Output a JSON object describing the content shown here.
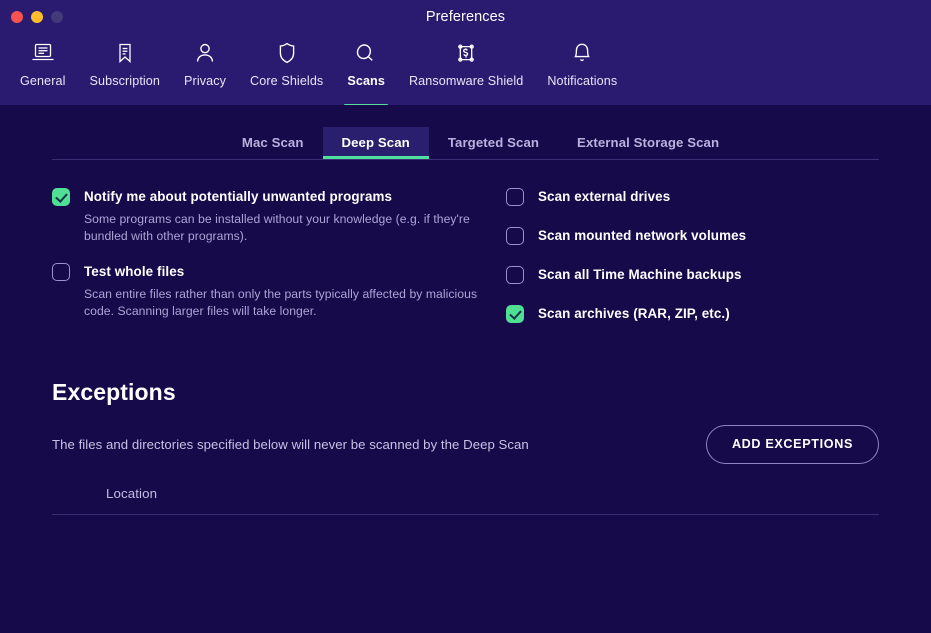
{
  "window": {
    "title": "Preferences",
    "traffic_lights": [
      {
        "name": "close",
        "color": "#f9534f"
      },
      {
        "name": "minimize",
        "color": "#fdbc2c"
      },
      {
        "name": "zoom",
        "color": "#433a7a"
      }
    ]
  },
  "toolbar": {
    "items": [
      {
        "label": "General",
        "icon": "document-laptop-icon",
        "active": false
      },
      {
        "label": "Subscription",
        "icon": "bookmark-icon",
        "active": false
      },
      {
        "label": "Privacy",
        "icon": "person-icon",
        "active": false
      },
      {
        "label": "Core Shields",
        "icon": "shield-icon",
        "active": false
      },
      {
        "label": "Scans",
        "icon": "magnifier-icon",
        "active": true
      },
      {
        "label": "Ransomware Shield",
        "icon": "money-lock-icon",
        "active": false
      },
      {
        "label": "Notifications",
        "icon": "bell-icon",
        "active": false
      }
    ]
  },
  "subtabs": [
    {
      "label": "Mac Scan",
      "active": false
    },
    {
      "label": "Deep Scan",
      "active": true
    },
    {
      "label": "Targeted Scan",
      "active": false
    },
    {
      "label": "External Storage Scan",
      "active": false
    }
  ],
  "options": {
    "left": [
      {
        "label": "Notify me about potentially unwanted programs",
        "checked": true,
        "description": "Some programs can be installed without your knowledge (e.g. if they're bundled with other programs)."
      },
      {
        "label": "Test whole files",
        "checked": false,
        "description": "Scan entire files rather than only the parts typically affected by malicious code. Scanning larger files will take longer."
      }
    ],
    "right": [
      {
        "label": "Scan external drives",
        "checked": false
      },
      {
        "label": "Scan mounted network volumes",
        "checked": false
      },
      {
        "label": "Scan all Time Machine backups",
        "checked": false
      },
      {
        "label": "Scan archives (RAR, ZIP, etc.)",
        "checked": true
      }
    ]
  },
  "exceptions": {
    "title": "Exceptions",
    "description": "The files and directories specified below will never be scanned by the Deep Scan",
    "add_button": "ADD EXCEPTIONS",
    "table": {
      "columns": [
        "Location"
      ],
      "rows": []
    }
  },
  "colors": {
    "accent_green": "#4fe0a0",
    "header_bg": "#2a1a70",
    "body_bg": "#170a4a",
    "active_tab_bg": "#2a1f6e",
    "muted_text": "#ada4d6",
    "divider": "#3a2f74"
  }
}
